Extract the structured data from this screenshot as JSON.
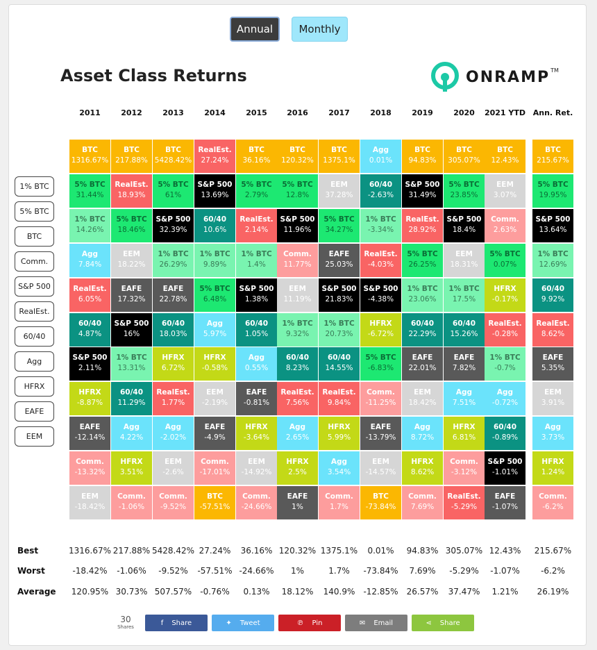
{
  "toggle": {
    "annual": "Annual",
    "monthly": "Monthly"
  },
  "title": "Asset Class Returns",
  "logo_text": "ONRAMP",
  "logo_tm": "TM",
  "years": [
    "2011",
    "2012",
    "2013",
    "2014",
    "2015",
    "2016",
    "2017",
    "2018",
    "2019",
    "2020",
    "2021 YTD"
  ],
  "ann_header": "Ann. Ret.",
  "colors": {
    "BTC": "#fbb702",
    "RealEst.": "#f96464",
    "Agg": "#6be3fb",
    "5% BTC": "#1de872",
    "1% BTC": "#79f4b0",
    "S&P 500": "#000000",
    "EEM": "#d6d6d6",
    "60/40": "#0b9282",
    "Comm.": "#fd9d9d",
    "EAFE": "#595959",
    "HFRX": "#c3d917"
  },
  "text_colors": {
    "BTC": "#ffffff",
    "RealEst.": "#ffffff",
    "Agg": "#ffffff",
    "5% BTC": "#0a6e36",
    "1% BTC": "#3a7d58",
    "S&P 500": "#ffffff",
    "EEM": "#ffffff",
    "60/40": "#ffffff",
    "Comm.": "#ffffff",
    "EAFE": "#ffffff",
    "HFRX": "#ffffff"
  },
  "grid": [
    [
      [
        "BTC",
        "1316.67%"
      ],
      [
        "5% BTC",
        "31.44%"
      ],
      [
        "1% BTC",
        "14.26%"
      ],
      [
        "Agg",
        "7.84%"
      ],
      [
        "RealEst.",
        "6.05%"
      ],
      [
        "60/40",
        "4.87%"
      ],
      [
        "S&P 500",
        "2.11%"
      ],
      [
        "HFRX",
        "-8.87%"
      ],
      [
        "EAFE",
        "-12.14%"
      ],
      [
        "Comm.",
        "-13.32%"
      ],
      [
        "EEM",
        "-18.42%"
      ]
    ],
    [
      [
        "BTC",
        "217.88%"
      ],
      [
        "RealEst.",
        "18.93%"
      ],
      [
        "5% BTC",
        "18.46%"
      ],
      [
        "EEM",
        "18.22%"
      ],
      [
        "EAFE",
        "17.32%"
      ],
      [
        "S&P 500",
        "16%"
      ],
      [
        "1% BTC",
        "13.31%"
      ],
      [
        "60/40",
        "11.29%"
      ],
      [
        "Agg",
        "4.22%"
      ],
      [
        "HFRX",
        "3.51%"
      ],
      [
        "Comm.",
        "-1.06%"
      ]
    ],
    [
      [
        "BTC",
        "5428.42%"
      ],
      [
        "5% BTC",
        "61%"
      ],
      [
        "S&P 500",
        "32.39%"
      ],
      [
        "1% BTC",
        "26.29%"
      ],
      [
        "EAFE",
        "22.78%"
      ],
      [
        "60/40",
        "18.03%"
      ],
      [
        "HFRX",
        "6.72%"
      ],
      [
        "RealEst.",
        "1.77%"
      ],
      [
        "Agg",
        "-2.02%"
      ],
      [
        "EEM",
        "-2.6%"
      ],
      [
        "Comm.",
        "-9.52%"
      ]
    ],
    [
      [
        "RealEst.",
        "27.24%"
      ],
      [
        "S&P 500",
        "13.69%"
      ],
      [
        "60/40",
        "10.6%"
      ],
      [
        "1% BTC",
        "9.89%"
      ],
      [
        "5% BTC",
        "6.48%"
      ],
      [
        "Agg",
        "5.97%"
      ],
      [
        "HFRX",
        "-0.58%"
      ],
      [
        "EEM",
        "-2.19%"
      ],
      [
        "EAFE",
        "-4.9%"
      ],
      [
        "Comm.",
        "-17.01%"
      ],
      [
        "BTC",
        "-57.51%"
      ]
    ],
    [
      [
        "BTC",
        "36.16%"
      ],
      [
        "5% BTC",
        "2.79%"
      ],
      [
        "RealEst.",
        "2.14%"
      ],
      [
        "1% BTC",
        "1.4%"
      ],
      [
        "S&P 500",
        "1.38%"
      ],
      [
        "60/40",
        "1.05%"
      ],
      [
        "Agg",
        "0.55%"
      ],
      [
        "EAFE",
        "-0.81%"
      ],
      [
        "HFRX",
        "-3.64%"
      ],
      [
        "EEM",
        "-14.92%"
      ],
      [
        "Comm.",
        "-24.66%"
      ]
    ],
    [
      [
        "BTC",
        "120.32%"
      ],
      [
        "5% BTC",
        "12.8%"
      ],
      [
        "S&P 500",
        "11.96%"
      ],
      [
        "Comm.",
        "11.77%"
      ],
      [
        "EEM",
        "11.19%"
      ],
      [
        "1% BTC",
        "9.32%"
      ],
      [
        "60/40",
        "8.23%"
      ],
      [
        "RealEst.",
        "7.56%"
      ],
      [
        "Agg",
        "2.65%"
      ],
      [
        "HFRX",
        "2.5%"
      ],
      [
        "EAFE",
        "1%"
      ]
    ],
    [
      [
        "BTC",
        "1375.1%"
      ],
      [
        "EEM",
        "37.28%"
      ],
      [
        "5% BTC",
        "34.27%"
      ],
      [
        "EAFE",
        "25.03%"
      ],
      [
        "S&P 500",
        "21.83%"
      ],
      [
        "1% BTC",
        "20.73%"
      ],
      [
        "60/40",
        "14.55%"
      ],
      [
        "RealEst.",
        "9.84%"
      ],
      [
        "HFRX",
        "5.99%"
      ],
      [
        "Agg",
        "3.54%"
      ],
      [
        "Comm.",
        "1.7%"
      ]
    ],
    [
      [
        "Agg",
        "0.01%"
      ],
      [
        "60/40",
        "-2.63%"
      ],
      [
        "1% BTC",
        "-3.34%"
      ],
      [
        "RealEst.",
        "-4.03%"
      ],
      [
        "S&P 500",
        "-4.38%"
      ],
      [
        "HFRX",
        "-6.72%"
      ],
      [
        "5% BTC",
        "-6.83%"
      ],
      [
        "Comm.",
        "-11.25%"
      ],
      [
        "EAFE",
        "-13.79%"
      ],
      [
        "EEM",
        "-14.57%"
      ],
      [
        "BTC",
        "-73.84%"
      ]
    ],
    [
      [
        "BTC",
        "94.83%"
      ],
      [
        "S&P 500",
        "31.49%"
      ],
      [
        "RealEst.",
        "28.92%"
      ],
      [
        "5% BTC",
        "26.25%"
      ],
      [
        "1% BTC",
        "23.06%"
      ],
      [
        "60/40",
        "22.29%"
      ],
      [
        "EAFE",
        "22.01%"
      ],
      [
        "EEM",
        "18.42%"
      ],
      [
        "Agg",
        "8.72%"
      ],
      [
        "HFRX",
        "8.62%"
      ],
      [
        "Comm.",
        "7.69%"
      ]
    ],
    [
      [
        "BTC",
        "305.07%"
      ],
      [
        "5% BTC",
        "23.85%"
      ],
      [
        "S&P 500",
        "18.4%"
      ],
      [
        "EEM",
        "18.31%"
      ],
      [
        "1% BTC",
        "17.5%"
      ],
      [
        "60/40",
        "15.26%"
      ],
      [
        "EAFE",
        "7.82%"
      ],
      [
        "Agg",
        "7.51%"
      ],
      [
        "HFRX",
        "6.81%"
      ],
      [
        "Comm.",
        "-3.12%"
      ],
      [
        "RealEst.",
        "-5.29%"
      ]
    ],
    [
      [
        "BTC",
        "12.43%"
      ],
      [
        "EEM",
        "3.07%"
      ],
      [
        "Comm.",
        "2.63%"
      ],
      [
        "5% BTC",
        "0.07%"
      ],
      [
        "HFRX",
        "-0.17%"
      ],
      [
        "RealEst.",
        "-0.28%"
      ],
      [
        "1% BTC",
        "-0.7%"
      ],
      [
        "Agg",
        "-0.72%"
      ],
      [
        "60/40",
        "-0.89%"
      ],
      [
        "S&P 500",
        "-1.01%"
      ],
      [
        "EAFE",
        "-1.07%"
      ]
    ]
  ],
  "ann": [
    [
      "BTC",
      "215.67%"
    ],
    [
      "5% BTC",
      "19.95%"
    ],
    [
      "S&P 500",
      "13.64%"
    ],
    [
      "1% BTC",
      "12.69%"
    ],
    [
      "60/40",
      "9.92%"
    ],
    [
      "RealEst.",
      "8.62%"
    ],
    [
      "EAFE",
      "5.35%"
    ],
    [
      "EEM",
      "3.91%"
    ],
    [
      "Agg",
      "3.73%"
    ],
    [
      "HFRX",
      "1.24%"
    ],
    [
      "Comm.",
      "-6.2%"
    ]
  ],
  "legend_buttons": [
    "1% BTC",
    "5% BTC",
    "BTC",
    "Comm.",
    "S&P 500",
    "RealEst.",
    "60/40",
    "Agg",
    "HFRX",
    "EAFE",
    "EEM"
  ],
  "stats": {
    "best_label": "Best",
    "worst_label": "Worst",
    "avg_label": "Average",
    "best": [
      "1316.67%",
      "217.88%",
      "5428.42%",
      "27.24%",
      "36.16%",
      "120.32%",
      "1375.1%",
      "0.01%",
      "94.83%",
      "305.07%",
      "12.43%",
      "215.67%"
    ],
    "worst": [
      "-18.42%",
      "-1.06%",
      "-9.52%",
      "-57.51%",
      "-24.66%",
      "1%",
      "1.7%",
      "-73.84%",
      "7.69%",
      "-5.29%",
      "-1.07%",
      "-6.2%"
    ],
    "average": [
      "120.95%",
      "30.73%",
      "507.57%",
      "-0.76%",
      "0.13%",
      "18.12%",
      "140.9%",
      "-12.85%",
      "26.57%",
      "37.47%",
      "1.21%",
      "26.19%"
    ]
  },
  "share": {
    "count": "30",
    "count_label": "Shares",
    "buttons": [
      {
        "label": "Share",
        "icon": "facebook-icon",
        "glyph": "f",
        "color": "#3b5998"
      },
      {
        "label": "Tweet",
        "icon": "twitter-icon",
        "glyph": "✦",
        "color": "#55acee"
      },
      {
        "label": "Pin",
        "icon": "pinterest-icon",
        "glyph": "℗",
        "color": "#cb2027"
      },
      {
        "label": "Email",
        "icon": "email-icon",
        "glyph": "✉",
        "color": "#7d7d7d"
      },
      {
        "label": "Share",
        "icon": "share-icon",
        "glyph": "⋖",
        "color": "#8dc63f"
      }
    ]
  }
}
